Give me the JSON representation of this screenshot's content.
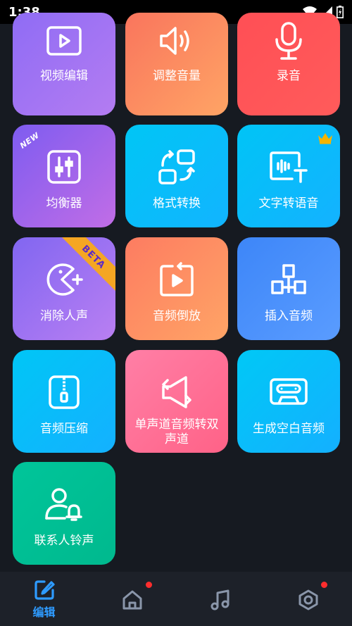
{
  "status_bar": {
    "time": "1:38"
  },
  "tiles": [
    {
      "label": "视频编辑",
      "icon": "video-edit-icon",
      "gradient": [
        "#8f6cf4",
        "#b47cf2"
      ]
    },
    {
      "label": "调整音量",
      "icon": "volume-icon",
      "gradient": [
        "#f9755d",
        "#ffa465"
      ]
    },
    {
      "label": "录音",
      "icon": "microphone-icon",
      "gradient": [
        "#ff4f55",
        "#ff5b5b"
      ]
    },
    {
      "label": "均衡器",
      "icon": "equalizer-icon",
      "gradient": [
        "#7e5cf0",
        "#c16de6"
      ],
      "badge": "NEW"
    },
    {
      "label": "格式转换",
      "icon": "format-convert-icon",
      "gradient": [
        "#00c6f5",
        "#12b4ff"
      ]
    },
    {
      "label": "文字转语音",
      "icon": "text-to-speech-icon",
      "gradient": [
        "#00c4f6",
        "#14b2ff"
      ],
      "badge_icon": "crown-icon"
    },
    {
      "label": "消除人声",
      "icon": "pacman-icon",
      "gradient": [
        "#8166f1",
        "#b97ff2"
      ],
      "badge": "BETA"
    },
    {
      "label": "音频倒放",
      "icon": "reverse-play-icon",
      "gradient": [
        "#fd7c61",
        "#ffa466"
      ]
    },
    {
      "label": "插入音频",
      "icon": "insert-audio-icon",
      "gradient": [
        "#3d86f8",
        "#5a9cff"
      ]
    },
    {
      "label": "音频压缩",
      "icon": "zip-icon",
      "gradient": [
        "#00c6f6",
        "#14b1ff"
      ]
    },
    {
      "label": "单声道音频转双声道",
      "icon": "mono-to-stereo-icon",
      "gradient": [
        "#ff7fa6",
        "#ff6287"
      ]
    },
    {
      "label": "生成空白音频",
      "icon": "cassette-icon",
      "gradient": [
        "#00c8f6",
        "#14b0ff"
      ]
    },
    {
      "label": "联系人铃声",
      "icon": "contact-ringtone-icon",
      "gradient": [
        "#00c59a",
        "#00b98e"
      ]
    }
  ],
  "bottom_nav": [
    {
      "label": "编辑",
      "icon": "edit-icon",
      "active": true
    },
    {
      "icon": "home-icon",
      "dot": true
    },
    {
      "icon": "music-icon"
    },
    {
      "icon": "settings-hex-icon",
      "dot": true
    }
  ],
  "colors": {
    "accent": "#2e9bff",
    "background": "#161a21",
    "nav_bg": "#1d2129",
    "dot": "#ff2d2d"
  }
}
